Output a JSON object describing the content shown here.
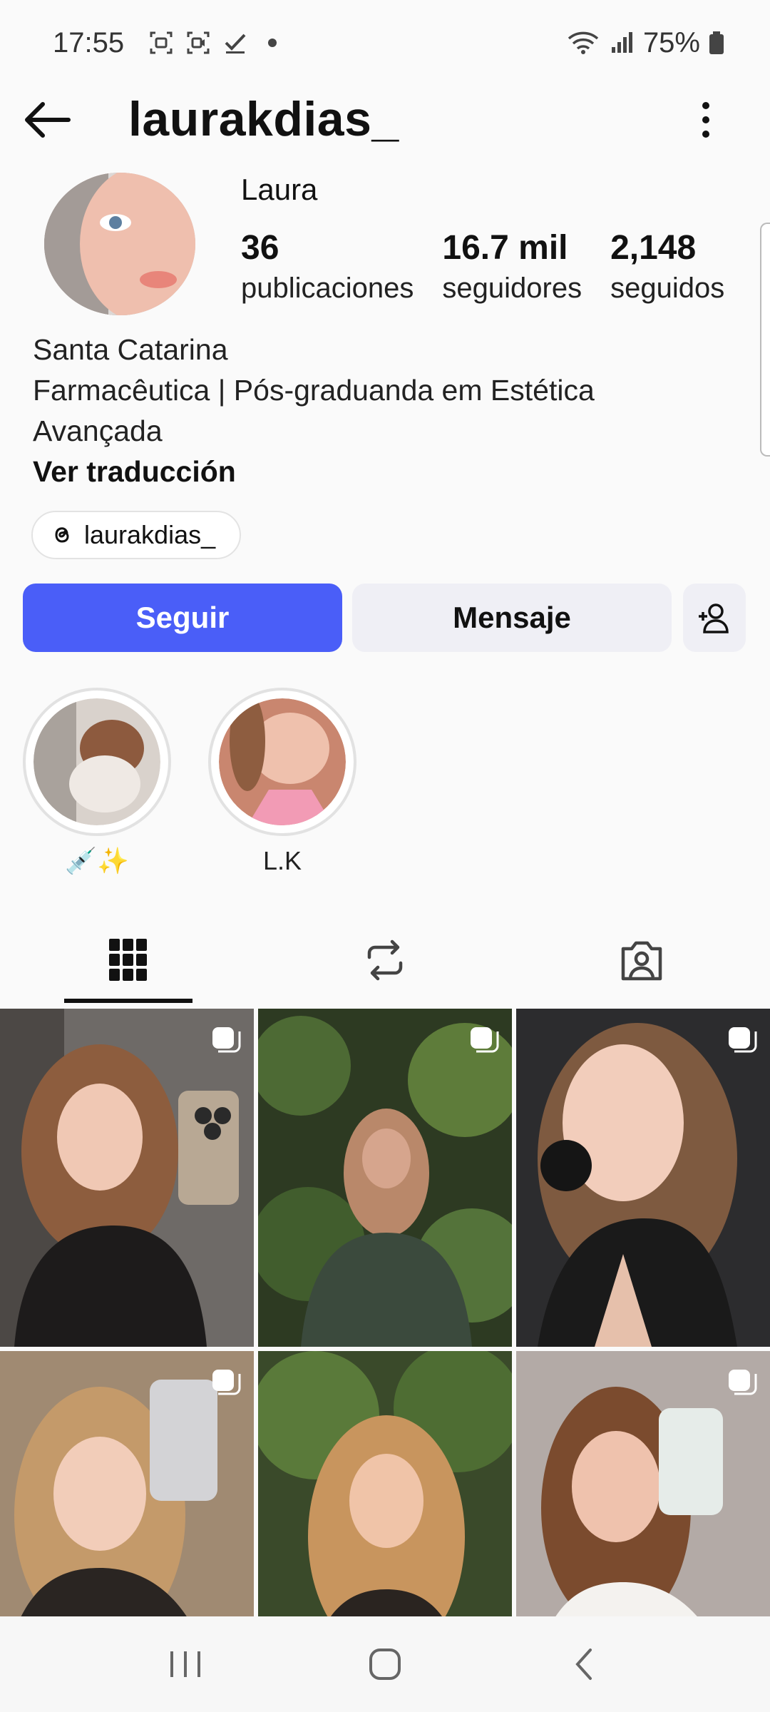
{
  "status_bar": {
    "time": "17:55",
    "battery": "75%"
  },
  "header": {
    "username": "laurakdias_"
  },
  "profile": {
    "display_name": "Laura",
    "stats": [
      {
        "value": "36",
        "label": "publicaciones"
      },
      {
        "value": "16.7 mil",
        "label": "seguidores"
      },
      {
        "value": "2,148",
        "label": "seguidos"
      }
    ],
    "bio_lines": [
      "Santa Catarina",
      "Farmacêutica | Pós-graduanda em Estética",
      "Avançada"
    ],
    "see_translation": "Ver traducción",
    "threads_handle": "laurakdias_"
  },
  "actions": {
    "follow": "Seguir",
    "message": "Mensaje"
  },
  "highlights": [
    {
      "label": "💉✨"
    },
    {
      "label": "L.K"
    }
  ],
  "colors": {
    "follow_button": "#4a5ef8",
    "secondary_button": "#efeff5"
  },
  "tabs": [
    "grid-icon",
    "reposts-icon",
    "tagged-icon"
  ]
}
